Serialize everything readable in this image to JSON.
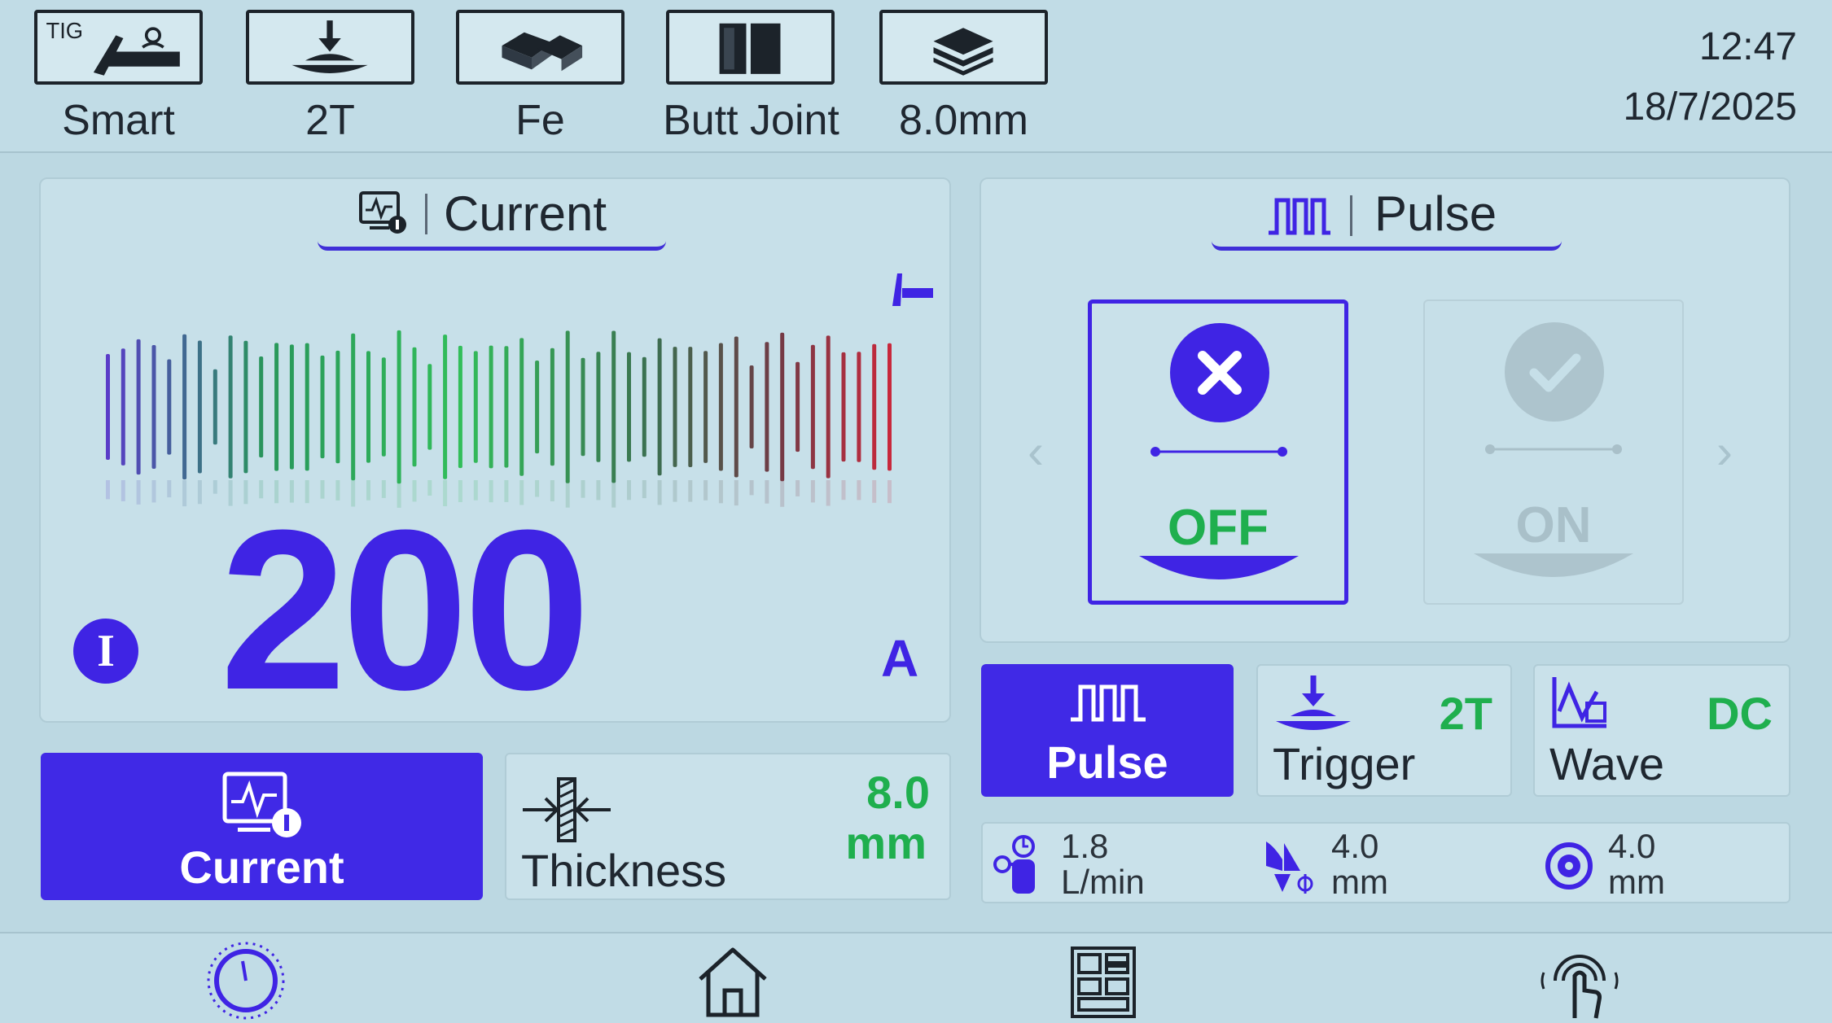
{
  "topbar": {
    "modes": [
      {
        "label": "Smart",
        "icon": "tig-torch-icon",
        "badge": "TIG"
      },
      {
        "label": "2T",
        "icon": "trigger-icon"
      },
      {
        "label": "Fe",
        "icon": "metal-ingot-icon"
      },
      {
        "label": "Butt Joint",
        "icon": "butt-joint-icon"
      },
      {
        "label": "8.0mm",
        "icon": "plate-stack-icon"
      }
    ],
    "time": "12:47",
    "date": "18/7/2025"
  },
  "current_panel": {
    "title": "Current",
    "value": "200",
    "unit": "A",
    "indicator": "I"
  },
  "pulse_panel": {
    "title": "Pulse",
    "options": [
      {
        "label": "OFF",
        "selected": true
      },
      {
        "label": "ON",
        "selected": false
      }
    ]
  },
  "bottom_left": {
    "current_button": "Current",
    "thickness_label": "Thickness",
    "thickness_value": "8.0",
    "thickness_unit": "mm"
  },
  "bottom_right": {
    "pulse_button": "Pulse",
    "trigger_label": "Trigger",
    "trigger_value": "2T",
    "wave_label": "Wave",
    "wave_value": "DC"
  },
  "info_row": [
    {
      "value": "1.8",
      "unit": "L/min",
      "icon": "gas-bottle-icon"
    },
    {
      "value": "4.0",
      "unit": "mm",
      "icon": "electrode-diameter-icon"
    },
    {
      "value": "4.0",
      "unit": "mm",
      "icon": "nozzle-icon"
    }
  ],
  "nav": [
    "dial-icon",
    "home-icon",
    "menu-grid-icon",
    "touch-icon"
  ],
  "colors": {
    "accent": "#4029e6",
    "green": "#1faf4e",
    "background": "#bcd8e2"
  }
}
